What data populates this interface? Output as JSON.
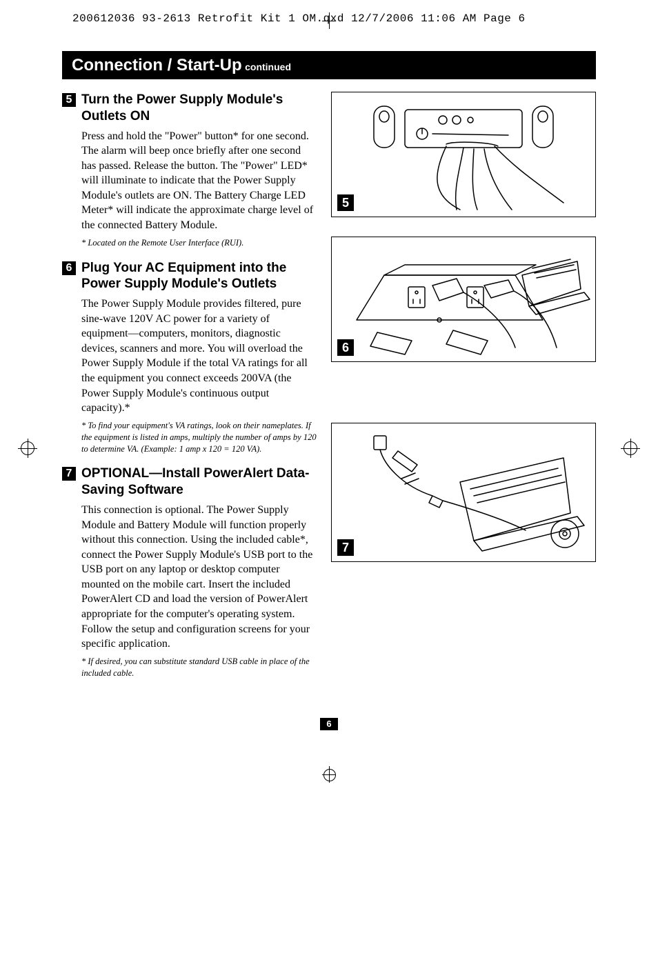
{
  "print_header": "200612036 93-2613 Retrofit Kit 1 OM.qxd  12/7/2006  11:06 AM  Page 6",
  "banner": {
    "title": "Connection / Start-Up",
    "suffix": "continued"
  },
  "steps": [
    {
      "num": "5",
      "title": "Turn the Power Supply Module's Outlets ON",
      "body": "Press and hold the \"Power\" button* for one second. The alarm will beep once briefly after one second has passed. Release the button. The \"Power\" LED* will illuminate to indicate that the Power Supply Module's outlets are ON. The Battery Charge LED Meter* will indicate the approximate charge level of the connected Battery Module.",
      "footnote": "* Located on the Remote User Interface (RUI)."
    },
    {
      "num": "6",
      "title": "Plug Your AC Equipment into the Power Supply Module's Outlets",
      "body": "The Power Supply Module provides filtered, pure sine-wave 120V AC power for a variety of equipment—computers, monitors, diagnostic devices, scanners and more. You will overload the Power Supply Module if the total VA ratings for all the equipment you connect exceeds 200VA (the Power Supply Module's continuous output capacity).*",
      "footnote": "* To find your equipment's VA ratings, look on their nameplates. If the equipment is listed in amps, multiply the number of amps by 120 to determine VA. (Example: 1 amp x 120 = 120 VA)."
    },
    {
      "num": "7",
      "title": "OPTIONAL—Install PowerAlert Data-Saving Software",
      "body": "This connection is optional. The Power Supply Module and Battery Module will function properly without this connection. Using the included cable*, connect the Power Supply Module's USB port to the USB port on any laptop or desktop computer mounted on the mobile cart. Insert the included PowerAlert CD and load the version of PowerAlert appropriate for the computer's operating system. Follow the setup and configuration screens for your specific application.",
      "footnote": "* If desired, you can substitute standard USB cable in place of the included cable."
    }
  ],
  "illust": [
    {
      "num": "5"
    },
    {
      "num": "6"
    },
    {
      "num": "7"
    }
  ],
  "page_number": "6"
}
